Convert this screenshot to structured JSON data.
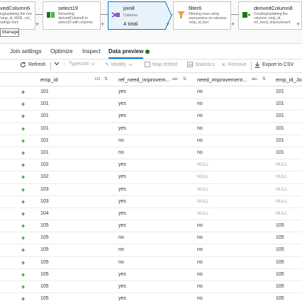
{
  "pipeline": {
    "manage_label": "Manage",
    "nodes": [
      {
        "title": "vedColumn6",
        "desc": "ing/updating the nns 'emp_id, MSR, ,ref_ ratings from"
      },
      {
        "title": "select19",
        "desc": "Renaming derivedColumn6 to select19 with columns"
      },
      {
        "title": "join8",
        "columns_label": "Columns:",
        "columns_value": "4 total"
      },
      {
        "title": "filter6",
        "desc": "Filtering rows using expressions on columns 'emp_id,Join'"
      },
      {
        "title": "derivedColumn8",
        "desc": "Creating/updating the columns 'emp_id, ref_need_improvement"
      }
    ]
  },
  "tabs": [
    {
      "label": "Join settings"
    },
    {
      "label": "Optimize"
    },
    {
      "label": "Inspect"
    },
    {
      "label": "Data preview"
    }
  ],
  "toolbar": {
    "refresh": "Refresh",
    "typecast": "Typecast",
    "modify": "Modify",
    "map_drifted": "Map drifted",
    "statistics": "Statistics",
    "remove": "Remove",
    "export": "Export to CSV"
  },
  "grid": {
    "columns": [
      "emp_id",
      "ref_need_improvem...",
      "need_improvement...",
      "emp_id_Join"
    ],
    "types": [
      "123",
      "abc",
      "abc",
      ""
    ],
    "rows": [
      [
        "101",
        "yes",
        "no",
        "101"
      ],
      [
        "101",
        "yes",
        "no",
        "101"
      ],
      [
        "101",
        "yes",
        "no",
        "101"
      ],
      [
        "101",
        "yes",
        "no",
        "101"
      ],
      [
        "101",
        "no",
        "no",
        "101"
      ],
      [
        "101",
        "no",
        "no",
        "101"
      ],
      [
        "102",
        "yes",
        "NULL",
        "NULL"
      ],
      [
        "102",
        "yes",
        "NULL",
        "NULL"
      ],
      [
        "103",
        "yes",
        "NULL",
        "NULL"
      ],
      [
        "103",
        "yes",
        "NULL",
        "NULL"
      ],
      [
        "104",
        "yes",
        "NULL",
        "NULL"
      ],
      [
        "105",
        "yes",
        "no",
        "105"
      ],
      [
        "105",
        "no",
        "no",
        "105"
      ],
      [
        "105",
        "no",
        "no",
        "105"
      ],
      [
        "105",
        "no",
        "no",
        "105"
      ],
      [
        "105",
        "yes",
        "no",
        "105"
      ],
      [
        "105",
        "yes",
        "no",
        "105"
      ],
      [
        "105",
        "yes",
        "no",
        "105"
      ]
    ]
  }
}
